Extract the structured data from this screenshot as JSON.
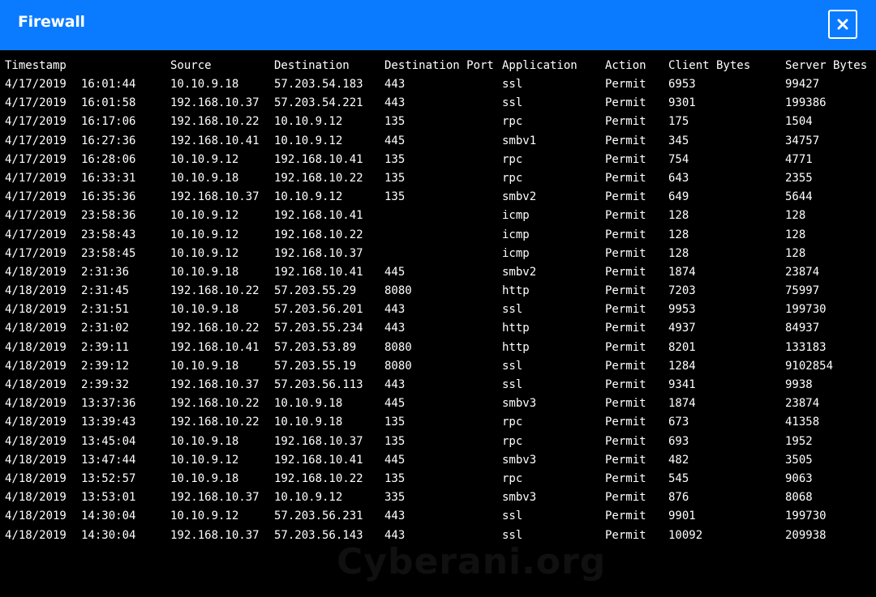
{
  "window": {
    "title": "Firewall",
    "close_icon": "close-icon",
    "accent_color": "#0a7bff"
  },
  "table": {
    "headers": {
      "timestamp": "Timestamp",
      "source": "Source",
      "destination": "Destination",
      "destination_port": "Destination Port",
      "application": "Application",
      "action": "Action",
      "client_bytes": "Client Bytes",
      "server_bytes": "Server Bytes"
    },
    "rows": [
      {
        "date": "4/17/2019",
        "time": "16:01:44",
        "source": "10.10.9.18",
        "destination": "57.203.54.183",
        "port": "443",
        "application": "ssl",
        "action": "Permit",
        "client_bytes": "6953",
        "server_bytes": "99427"
      },
      {
        "date": "4/17/2019",
        "time": "16:01:58",
        "source": "192.168.10.37",
        "destination": "57.203.54.221",
        "port": "443",
        "application": "ssl",
        "action": "Permit",
        "client_bytes": "9301",
        "server_bytes": "199386"
      },
      {
        "date": "4/17/2019",
        "time": "16:17:06",
        "source": "192.168.10.22",
        "destination": "10.10.9.12",
        "port": "135",
        "application": "rpc",
        "action": "Permit",
        "client_bytes": "175",
        "server_bytes": "1504"
      },
      {
        "date": "4/17/2019",
        "time": "16:27:36",
        "source": "192.168.10.41",
        "destination": "10.10.9.12",
        "port": "445",
        "application": "smbv1",
        "action": "Permit",
        "client_bytes": "345",
        "server_bytes": "34757"
      },
      {
        "date": "4/17/2019",
        "time": "16:28:06",
        "source": "10.10.9.12",
        "destination": "192.168.10.41",
        "port": "135",
        "application": "rpc",
        "action": "Permit",
        "client_bytes": "754",
        "server_bytes": "4771"
      },
      {
        "date": "4/17/2019",
        "time": "16:33:31",
        "source": "10.10.9.18",
        "destination": "192.168.10.22",
        "port": "135",
        "application": "rpc",
        "action": "Permit",
        "client_bytes": "643",
        "server_bytes": "2355"
      },
      {
        "date": "4/17/2019",
        "time": "16:35:36",
        "source": "192.168.10.37",
        "destination": "10.10.9.12",
        "port": "135",
        "application": "smbv2",
        "action": "Permit",
        "client_bytes": "649",
        "server_bytes": "5644"
      },
      {
        "date": "4/17/2019",
        "time": "23:58:36",
        "source": "10.10.9.12",
        "destination": "192.168.10.41",
        "port": "",
        "application": "icmp",
        "action": "Permit",
        "client_bytes": "128",
        "server_bytes": "128"
      },
      {
        "date": "4/17/2019",
        "time": "23:58:43",
        "source": "10.10.9.12",
        "destination": "192.168.10.22",
        "port": "",
        "application": "icmp",
        "action": "Permit",
        "client_bytes": "128",
        "server_bytes": "128"
      },
      {
        "date": "4/17/2019",
        "time": "23:58:45",
        "source": "10.10.9.12",
        "destination": "192.168.10.37",
        "port": "",
        "application": "icmp",
        "action": "Permit",
        "client_bytes": "128",
        "server_bytes": "128"
      },
      {
        "date": "4/18/2019",
        "time": "2:31:36",
        "source": "10.10.9.18",
        "destination": "192.168.10.41",
        "port": "445",
        "application": "smbv2",
        "action": "Permit",
        "client_bytes": "1874",
        "server_bytes": "23874"
      },
      {
        "date": "4/18/2019",
        "time": "2:31:45",
        "source": "192.168.10.22",
        "destination": "57.203.55.29",
        "port": "8080",
        "application": "http",
        "action": "Permit",
        "client_bytes": "7203",
        "server_bytes": "75997"
      },
      {
        "date": "4/18/2019",
        "time": "2:31:51",
        "source": "10.10.9.18",
        "destination": "57.203.56.201",
        "port": "443",
        "application": "ssl",
        "action": "Permit",
        "client_bytes": "9953",
        "server_bytes": "199730"
      },
      {
        "date": "4/18/2019",
        "time": "2:31:02",
        "source": "192.168.10.22",
        "destination": "57.203.55.234",
        "port": "443",
        "application": "http",
        "action": "Permit",
        "client_bytes": "4937",
        "server_bytes": "84937"
      },
      {
        "date": "4/18/2019",
        "time": "2:39:11",
        "source": "192.168.10.41",
        "destination": "57.203.53.89",
        "port": "8080",
        "application": "http",
        "action": "Permit",
        "client_bytes": "8201",
        "server_bytes": "133183"
      },
      {
        "date": "4/18/2019",
        "time": "2:39:12",
        "source": "10.10.9.18",
        "destination": "57.203.55.19",
        "port": "8080",
        "application": "ssl",
        "action": "Permit",
        "client_bytes": "1284",
        "server_bytes": "9102854"
      },
      {
        "date": "4/18/2019",
        "time": "2:39:32",
        "source": "192.168.10.37",
        "destination": "57.203.56.113",
        "port": "443",
        "application": "ssl",
        "action": "Permit",
        "client_bytes": "9341",
        "server_bytes": "9938"
      },
      {
        "date": "4/18/2019",
        "time": "13:37:36",
        "source": "192.168.10.22",
        "destination": "10.10.9.18",
        "port": "445",
        "application": "smbv3",
        "action": "Permit",
        "client_bytes": "1874",
        "server_bytes": "23874"
      },
      {
        "date": "4/18/2019",
        "time": "13:39:43",
        "source": "192.168.10.22",
        "destination": "10.10.9.18",
        "port": "135",
        "application": "rpc",
        "action": "Permit",
        "client_bytes": "673",
        "server_bytes": "41358"
      },
      {
        "date": "4/18/2019",
        "time": "13:45:04",
        "source": "10.10.9.18",
        "destination": "192.168.10.37",
        "port": "135",
        "application": "rpc",
        "action": "Permit",
        "client_bytes": "693",
        "server_bytes": "1952"
      },
      {
        "date": "4/18/2019",
        "time": "13:47:44",
        "source": "10.10.9.12",
        "destination": "192.168.10.41",
        "port": "445",
        "application": "smbv3",
        "action": "Permit",
        "client_bytes": "482",
        "server_bytes": "3505"
      },
      {
        "date": "4/18/2019",
        "time": "13:52:57",
        "source": "10.10.9.18",
        "destination": "192.168.10.22",
        "port": "135",
        "application": "rpc",
        "action": "Permit",
        "client_bytes": "545",
        "server_bytes": "9063"
      },
      {
        "date": "4/18/2019",
        "time": "13:53:01",
        "source": "192.168.10.37",
        "destination": "10.10.9.12",
        "port": "335",
        "application": "smbv3",
        "action": "Permit",
        "client_bytes": "876",
        "server_bytes": "8068"
      },
      {
        "date": "4/18/2019",
        "time": "14:30:04",
        "source": "10.10.9.12",
        "destination": "57.203.56.231",
        "port": "443",
        "application": "ssl",
        "action": "Permit",
        "client_bytes": "9901",
        "server_bytes": "199730"
      },
      {
        "date": "4/18/2019",
        "time": "14:30:04",
        "source": "192.168.10.37",
        "destination": "57.203.56.143",
        "port": "443",
        "application": "ssl",
        "action": "Permit",
        "client_bytes": "10092",
        "server_bytes": "209938"
      }
    ]
  },
  "watermark": "Cyberani.org"
}
